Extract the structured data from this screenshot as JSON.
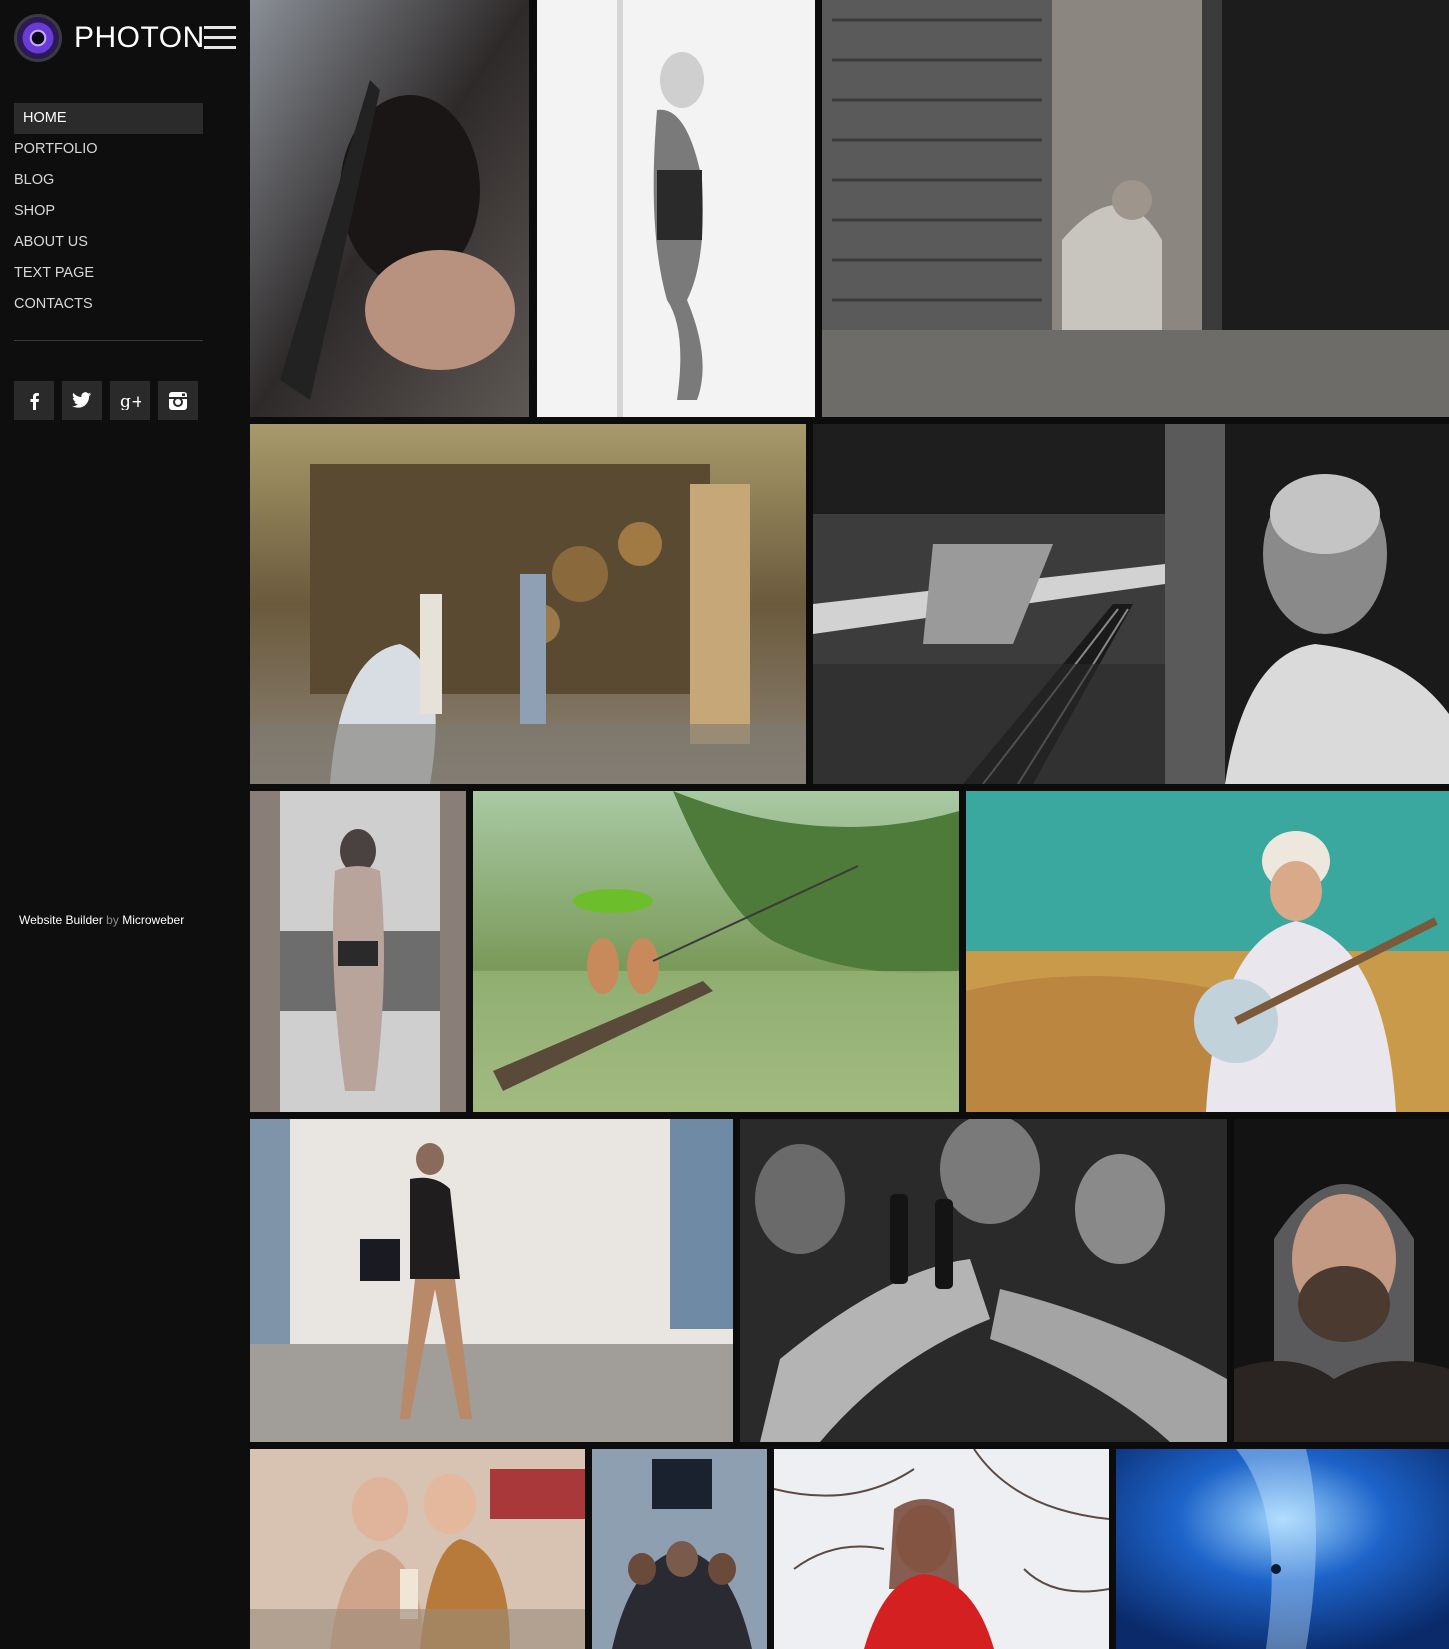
{
  "brand": {
    "name": "PHOTON"
  },
  "nav": {
    "items": [
      {
        "label": "HOME",
        "active": true
      },
      {
        "label": "PORTFOLIO"
      },
      {
        "label": "BLOG"
      },
      {
        "label": "SHOP"
      },
      {
        "label": "ABOUT US"
      },
      {
        "label": "TEXT PAGE"
      },
      {
        "label": "CONTACTS"
      }
    ]
  },
  "social": [
    {
      "name": "facebook-icon",
      "glyph": "f"
    },
    {
      "name": "twitter-icon",
      "glyph": "🐦"
    },
    {
      "name": "google-plus-icon",
      "glyph": "g+"
    },
    {
      "name": "instagram-icon",
      "glyph": "◙"
    }
  ],
  "footer": {
    "builder": "Website Builder",
    "by": "by",
    "vendor": "Microweber"
  },
  "colors": {
    "sidebar_bg": "#0e0e0f",
    "page_bg": "#0c0c0c",
    "active_item_bg": "#2b2b2b",
    "text": "#d8d8d8"
  },
  "gallery": {
    "photos": [
      {
        "name": "photo-woman-chair",
        "kind": "portrait-dark"
      },
      {
        "name": "photo-woman-pole",
        "kind": "bw-light"
      },
      {
        "name": "photo-old-man-door",
        "kind": "bw-dark"
      },
      {
        "name": "photo-market-street",
        "kind": "color-warm"
      },
      {
        "name": "photo-train-station",
        "kind": "bw-dark"
      },
      {
        "name": "photo-man-portrait-bw",
        "kind": "bw-dark"
      },
      {
        "name": "photo-woman-window",
        "kind": "gray-light"
      },
      {
        "name": "photo-kids-fishing",
        "kind": "color-green"
      },
      {
        "name": "photo-banjo-player",
        "kind": "color-teal"
      },
      {
        "name": "photo-woman-handbag",
        "kind": "color-light"
      },
      {
        "name": "photo-beer-toast",
        "kind": "bw-dark"
      },
      {
        "name": "photo-bearded-man",
        "kind": "color-dark"
      },
      {
        "name": "photo-diner-girls",
        "kind": "color-retro"
      },
      {
        "name": "photo-gate-group",
        "kind": "color-cool"
      },
      {
        "name": "photo-woman-red-coat",
        "kind": "color-snow"
      },
      {
        "name": "photo-ice-cave",
        "kind": "color-blue"
      }
    ]
  }
}
